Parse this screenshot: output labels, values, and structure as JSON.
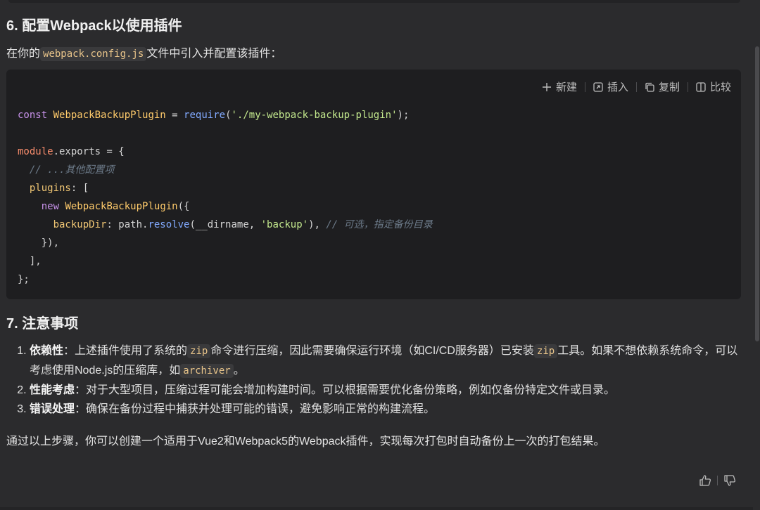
{
  "section6": {
    "title": "6. 配置Webpack以使用插件"
  },
  "intro": {
    "prefix": "在你的",
    "file": "webpack.config.js",
    "suffix": "文件中引入并配置该插件："
  },
  "toolbar": {
    "new_label": "新建",
    "insert_label": "插入",
    "copy_label": "复制",
    "compare_label": "比较"
  },
  "code": {
    "l1_kw": "const",
    "l1_name": "WebpackBackupPlugin",
    "l1_eq": " = ",
    "l1_fn": "require",
    "l1_str": "'./my-webpack-backup-plugin'",
    "l1_end": ");",
    "l3_a": "module",
    "l3_b": ".exports = {",
    "l4_cm": "// ...其他配置项",
    "l5_key": "plugins",
    "l5_rest": ": [",
    "l6_kw": "new",
    "l6_cls": "WebpackBackupPlugin",
    "l6_rest": "({",
    "l7_key": "backupDir",
    "l7_a": ": path.",
    "l7_fn": "resolve",
    "l7_b": "(__dirname, ",
    "l7_str": "'backup'",
    "l7_c": "), ",
    "l7_cm": "// 可选，指定备份目录",
    "l8": "}),",
    "l9": "],",
    "l10": "};"
  },
  "section7": {
    "title": "7. 注意事项"
  },
  "notes": [
    {
      "label": "依赖性",
      "t1": "：上述插件使用了系统的",
      "c1": "zip",
      "t2": "命令进行压缩，因此需要确保运行环境（如CI/CD服务器）已安装",
      "c2": "zip",
      "t3": "工具。如果不想依赖系统命令，可以考虑使用Node.js的压缩库，如",
      "c3": "archiver",
      "t4": "。"
    },
    {
      "label": "性能考虑",
      "text": "：对于大型项目，压缩过程可能会增加构建时间。可以根据需要优化备份策略，例如仅备份特定文件或目录。"
    },
    {
      "label": "错误处理",
      "text": "：确保在备份过程中捕获并处理可能的错误，避免影响正常的构建流程。"
    }
  ],
  "summary": "通过以上步骤，你可以创建一个适用于Vue2和Webpack5的Webpack插件，实现每次打包时自动备份上一次的打包结果。",
  "icons": {
    "new": "plus-icon",
    "insert": "insert-icon",
    "copy": "copy-icon",
    "compare": "compare-icon",
    "like": "thumbs-up-icon",
    "dislike": "thumbs-down-icon"
  }
}
